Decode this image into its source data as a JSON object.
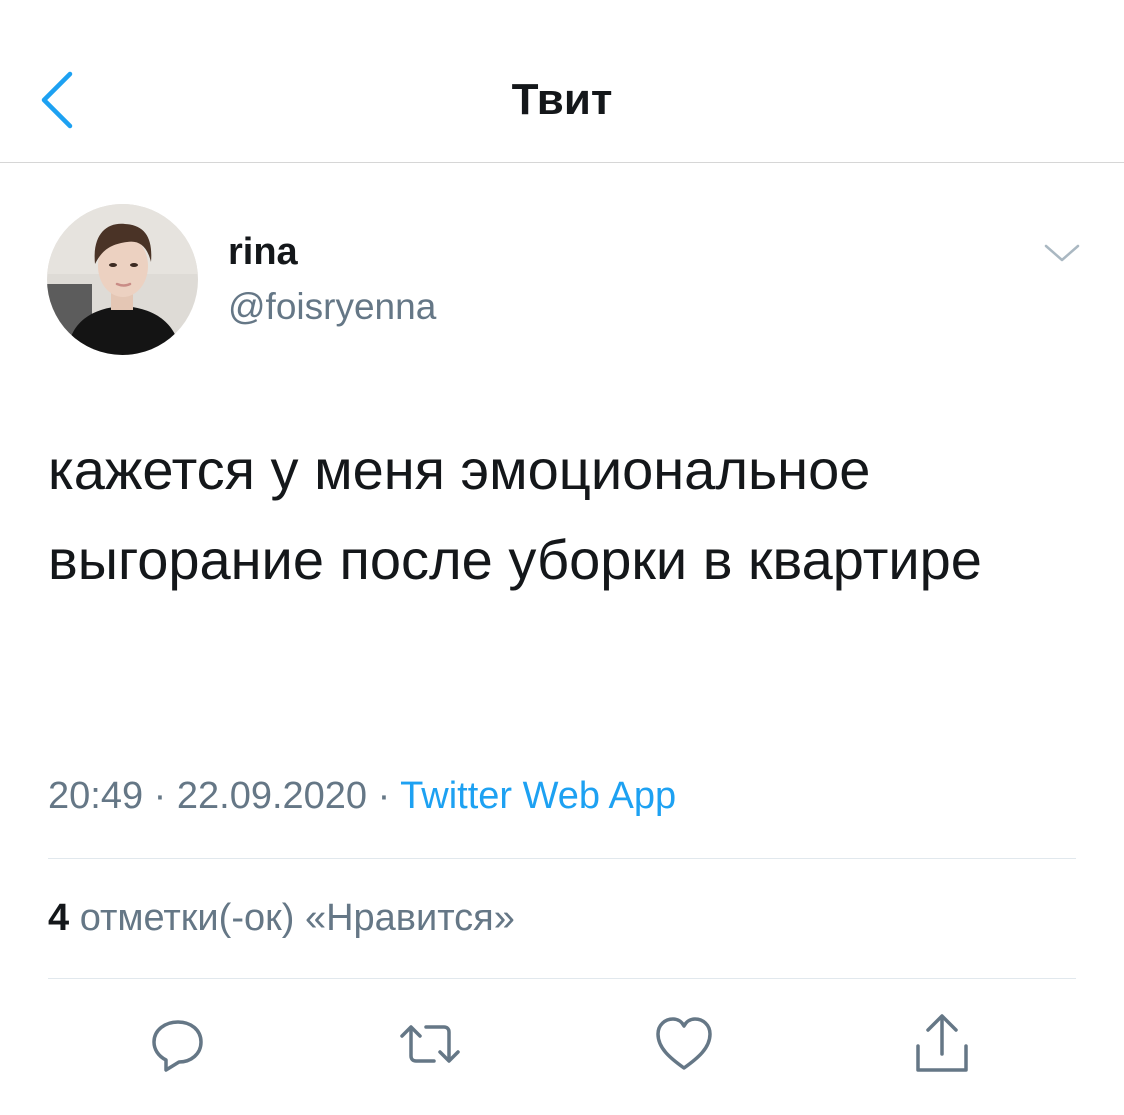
{
  "header": {
    "title": "Твит",
    "back_icon": "chevron-left-icon"
  },
  "colors": {
    "accent": "#1da1f2",
    "secondary_text": "#657786",
    "primary_text": "#14171a",
    "divider": "#e1e8ed"
  },
  "author": {
    "display_name": "rina",
    "handle": "@foisryenna"
  },
  "tweet": {
    "text": "кажется у меня эмоциональное выгорание после уборки в квартире",
    "time": "20:49",
    "separator": "·",
    "date": "22.09.2020",
    "source": "Twitter Web App"
  },
  "stats": {
    "likes_count": "4",
    "likes_label": "отметки(-ок) «Нравится»"
  },
  "actions": [
    {
      "icon": "reply-icon"
    },
    {
      "icon": "retweet-icon"
    },
    {
      "icon": "heart-icon"
    },
    {
      "icon": "share-icon"
    }
  ]
}
